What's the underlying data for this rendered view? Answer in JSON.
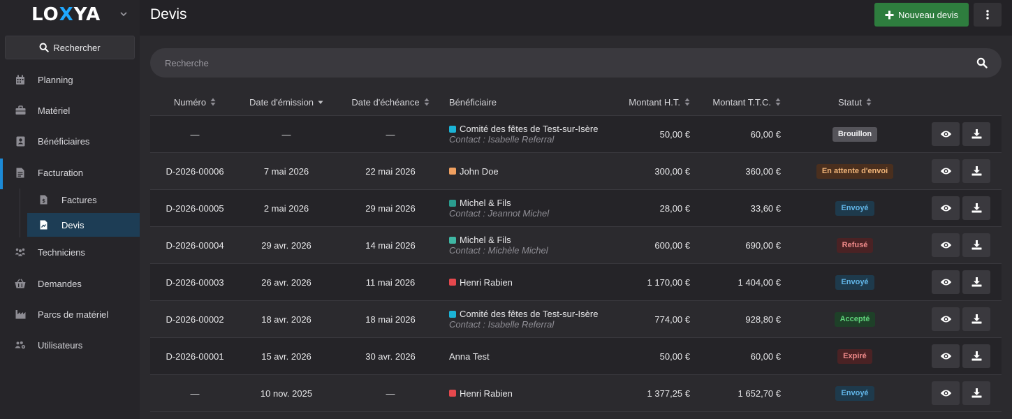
{
  "app": {
    "logo_left": "LO",
    "logo_x": "X",
    "logo_right": "YA",
    "logo_accent": "#1fa8ff"
  },
  "sidebar": {
    "search_label": "Rechercher",
    "items": [
      {
        "label": "Planning",
        "icon": "calendar-icon"
      },
      {
        "label": "Matériel",
        "icon": "toolbox-icon"
      },
      {
        "label": "Bénéficiaires",
        "icon": "address-book-icon"
      },
      {
        "label": "Facturation",
        "icon": "invoice-icon"
      },
      {
        "label": "Techniciens",
        "icon": "people-icon"
      },
      {
        "label": "Demandes",
        "icon": "basket-icon"
      },
      {
        "label": "Parcs de matériel",
        "icon": "industry-icon"
      },
      {
        "label": "Utilisateurs",
        "icon": "users-cog-icon"
      }
    ],
    "sub_items": [
      {
        "label": "Factures",
        "icon": "invoice-dollar-icon"
      },
      {
        "label": "Devis",
        "icon": "quote-icon",
        "active": true
      }
    ]
  },
  "header": {
    "title": "Devis",
    "new_button_label": "Nouveau devis",
    "new_button_color": "#2e7d3e"
  },
  "search": {
    "placeholder": "Recherche"
  },
  "table": {
    "columns": {
      "numero": "Numéro",
      "date_emission": "Date d'émission",
      "date_echeance": "Date d'échéance",
      "beneficiaire": "Bénéficiaire",
      "montant_ht": "Montant H.T.",
      "montant_ttc": "Montant T.T.C.",
      "statut": "Statut"
    },
    "rows": [
      {
        "numero": "—",
        "date_emission": "—",
        "date_echeance": "—",
        "beneficiaire": "Comité des fêtes de Test-sur-Isère",
        "contact": "Contact : Isabelle Referral",
        "dot_color": "#1bb3d6",
        "montant_ht": "50,00 €",
        "montant_ttc": "60,00 €",
        "statut": "Brouillon",
        "statut_bg": "#55545a",
        "statut_fg": "#f2f2f4"
      },
      {
        "numero": "D-2026-00006",
        "date_emission": "7 mai 2026",
        "date_echeance": "22 mai 2026",
        "beneficiaire": "John Doe",
        "contact": "",
        "dot_color": "#f0a060",
        "montant_ht": "300,00 €",
        "montant_ttc": "360,00 €",
        "statut": "En attente d'envoi",
        "statut_bg": "#4a2f1e",
        "statut_fg": "#f3b679"
      },
      {
        "numero": "D-2026-00005",
        "date_emission": "2 mai 2026",
        "date_echeance": "29 mai 2026",
        "beneficiaire": "Michel & Fils",
        "contact": "Contact : Jeannot Michel",
        "dot_color": "#2a9d8f",
        "montant_ht": "28,00 €",
        "montant_ttc": "33,60 €",
        "statut": "Envoyé",
        "statut_bg": "#1e3a4c",
        "statut_fg": "#62b6e8"
      },
      {
        "numero": "D-2026-00004",
        "date_emission": "29 avr. 2026",
        "date_echeance": "14 mai 2026",
        "beneficiaire": "Michel & Fils",
        "contact": "Contact : Michèle Michel",
        "dot_color": "#3fb7a4",
        "montant_ht": "600,00 €",
        "montant_ttc": "690,00 €",
        "statut": "Refusé",
        "statut_bg": "#4a2224",
        "statut_fg": "#f08a8a"
      },
      {
        "numero": "D-2026-00003",
        "date_emission": "26 avr. 2026",
        "date_echeance": "11 mai 2026",
        "beneficiaire": "Henri Rabien",
        "contact": "",
        "dot_color": "#e5484d",
        "montant_ht": "1 170,00 €",
        "montant_ttc": "1 404,00 €",
        "statut": "Envoyé",
        "statut_bg": "#1e3a4c",
        "statut_fg": "#62b6e8"
      },
      {
        "numero": "D-2026-00002",
        "date_emission": "18 avr. 2026",
        "date_echeance": "18 mai 2026",
        "beneficiaire": "Comité des fêtes de Test-sur-Isère",
        "contact": "Contact : Isabelle Referral",
        "dot_color": "#1bb3d6",
        "montant_ht": "774,00 €",
        "montant_ttc": "928,80 €",
        "statut": "Accepté",
        "statut_bg": "#1e4028",
        "statut_fg": "#5fd37a"
      },
      {
        "numero": "D-2026-00001",
        "date_emission": "15 avr. 2026",
        "date_echeance": "30 avr. 2026",
        "beneficiaire": "Anna Test",
        "contact": "",
        "dot_color": "",
        "montant_ht": "50,00 €",
        "montant_ttc": "60,00 €",
        "statut": "Expiré",
        "statut_bg": "#4a2224",
        "statut_fg": "#f08a8a"
      },
      {
        "numero": "—",
        "date_emission": "10 nov. 2025",
        "date_echeance": "—",
        "beneficiaire": "Henri Rabien",
        "contact": "",
        "dot_color": "#e5484d",
        "montant_ht": "1 377,25 €",
        "montant_ttc": "1 652,70 €",
        "statut": "Envoyé",
        "statut_bg": "#1e3a4c",
        "statut_fg": "#62b6e8"
      }
    ]
  }
}
